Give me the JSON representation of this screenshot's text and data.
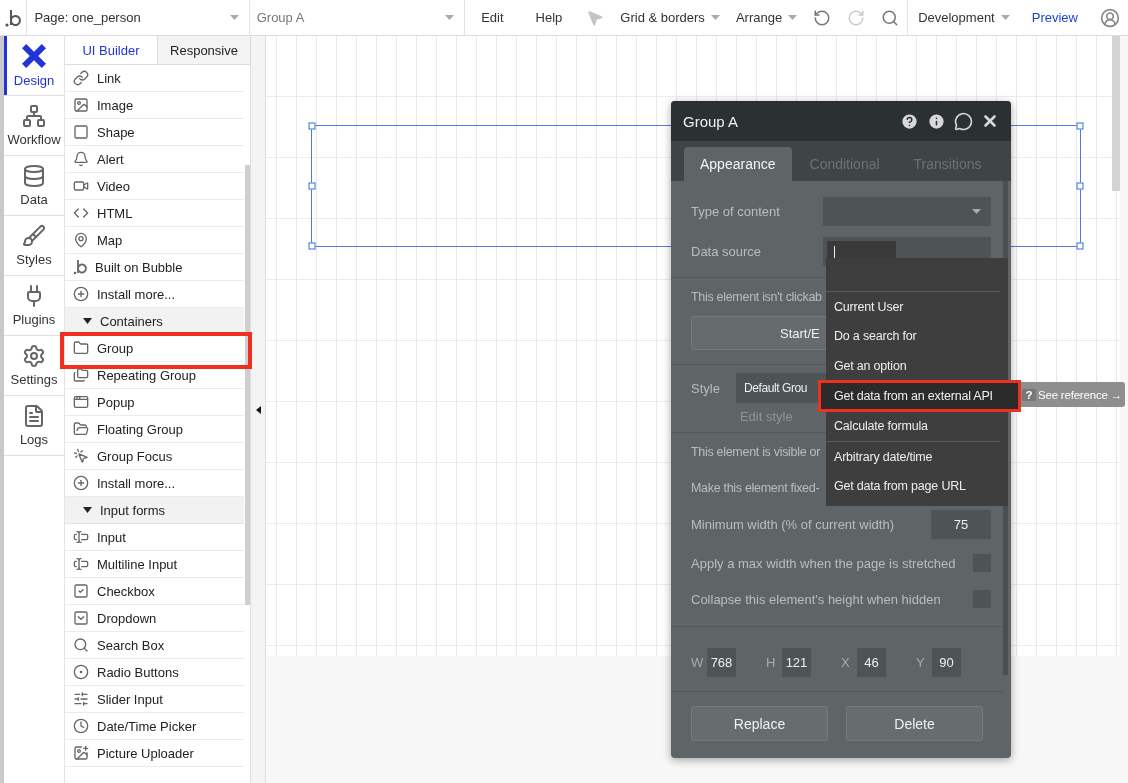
{
  "topbar": {
    "page_selector": "Page: one_person",
    "element_selector": "Group A",
    "menus": [
      "Edit",
      "Help"
    ],
    "grid_menu": "Grid & borders",
    "arrange_menu": "Arrange",
    "version_menu": "Development",
    "preview": "Preview"
  },
  "rail": [
    {
      "label": "Design",
      "selected": true
    },
    {
      "label": "Workflow",
      "selected": false
    },
    {
      "label": "Data",
      "selected": false
    },
    {
      "label": "Styles",
      "selected": false
    },
    {
      "label": "Plugins",
      "selected": false
    },
    {
      "label": "Settings",
      "selected": false
    },
    {
      "label": "Logs",
      "selected": false
    }
  ],
  "palette": {
    "tabs": [
      {
        "label": "UI Builder",
        "selected": true
      },
      {
        "label": "Responsive",
        "selected": false
      }
    ],
    "items": [
      {
        "kind": "item",
        "label": "Link",
        "highlighted": false
      },
      {
        "kind": "item",
        "label": "Image",
        "highlighted": false
      },
      {
        "kind": "item",
        "label": "Shape",
        "highlighted": false
      },
      {
        "kind": "item",
        "label": "Alert",
        "highlighted": false
      },
      {
        "kind": "item",
        "label": "Video",
        "highlighted": false
      },
      {
        "kind": "item",
        "label": "HTML",
        "highlighted": false
      },
      {
        "kind": "item",
        "label": "Map",
        "highlighted": false
      },
      {
        "kind": "item",
        "label": "Built on Bubble",
        "highlighted": false
      },
      {
        "kind": "item",
        "label": "Install more...",
        "highlighted": false
      },
      {
        "kind": "section",
        "label": "Containers",
        "expanded": true
      },
      {
        "kind": "item",
        "label": "Group",
        "highlighted": true
      },
      {
        "kind": "item",
        "label": "Repeating Group",
        "highlighted": false
      },
      {
        "kind": "item",
        "label": "Popup",
        "highlighted": false
      },
      {
        "kind": "item",
        "label": "Floating Group",
        "highlighted": false
      },
      {
        "kind": "item",
        "label": "Group Focus",
        "highlighted": false
      },
      {
        "kind": "item",
        "label": "Install more...",
        "highlighted": false
      },
      {
        "kind": "section",
        "label": "Input forms",
        "expanded": true
      },
      {
        "kind": "item",
        "label": "Input",
        "highlighted": false
      },
      {
        "kind": "item",
        "label": "Multiline Input",
        "highlighted": false
      },
      {
        "kind": "item",
        "label": "Checkbox",
        "highlighted": false
      },
      {
        "kind": "item",
        "label": "Dropdown",
        "highlighted": false
      },
      {
        "kind": "item",
        "label": "Search Box",
        "highlighted": false
      },
      {
        "kind": "item",
        "label": "Radio Buttons",
        "highlighted": false
      },
      {
        "kind": "item",
        "label": "Slider Input",
        "highlighted": false
      },
      {
        "kind": "item",
        "label": "Date/Time Picker",
        "highlighted": false
      },
      {
        "kind": "item",
        "label": "Picture Uploader",
        "highlighted": false
      }
    ]
  },
  "property_editor": {
    "title": "Group A",
    "tabs": [
      {
        "label": "Appearance",
        "selected": true
      },
      {
        "label": "Conditional",
        "selected": false
      },
      {
        "label": "Transitions",
        "selected": false
      }
    ],
    "type_of_content": {
      "label": "Type of content"
    },
    "data_source": {
      "label": "Data source"
    },
    "clickable_note": "This element isn't clickab",
    "workflow_button": "Start/E",
    "style": {
      "label": "Style",
      "value": "Default Grou",
      "edit_link": "Edit style"
    },
    "visible_note": "This element is visible or",
    "fixed_width": {
      "label": "Make this element fixed-"
    },
    "min_width": {
      "label": "Minimum width (% of current width)",
      "value": "75"
    },
    "max_width": {
      "label": "Apply a max width when the page is stretched",
      "checked": false
    },
    "collapse": {
      "label": "Collapse this element's height when hidden",
      "checked": false
    },
    "geometry": [
      {
        "label": "W",
        "value": "768"
      },
      {
        "label": "H",
        "value": "121"
      },
      {
        "label": "X",
        "value": "46"
      },
      {
        "label": "Y",
        "value": "90"
      }
    ],
    "buttons": [
      "Replace",
      "Delete"
    ]
  },
  "data_source_menu": {
    "items": [
      {
        "label": "Current User",
        "divider_before": true,
        "highlighted": false
      },
      {
        "label": "Do a search for",
        "divider_before": false,
        "highlighted": false
      },
      {
        "label": "Get an option",
        "divider_before": false,
        "highlighted": false
      },
      {
        "label": "Get data from an external API",
        "divider_before": false,
        "highlighted": true
      },
      {
        "label": "Calculate formula",
        "divider_before": false,
        "highlighted": false
      },
      {
        "label": "Arbitrary date/time",
        "divider_before": true,
        "highlighted": false
      },
      {
        "label": "Get data from page URL",
        "divider_before": false,
        "highlighted": false
      }
    ]
  },
  "tooltip": {
    "badge": "?",
    "label": "See reference →"
  }
}
